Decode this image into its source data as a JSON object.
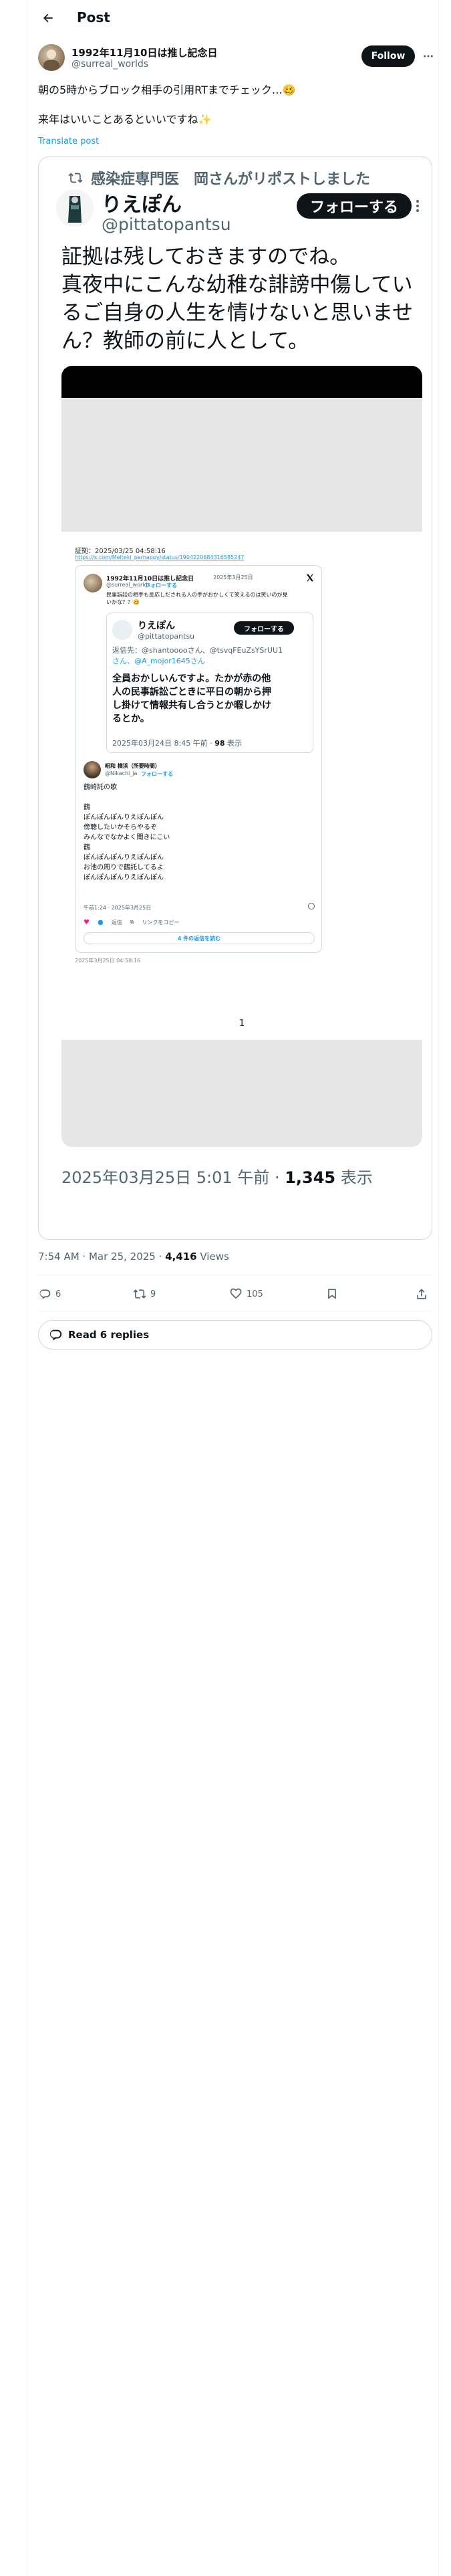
{
  "header": {
    "title": "Post"
  },
  "author": {
    "name": "1992年11月10日は推し記念日",
    "handle": "@surreal_worlds",
    "follow_label": "Follow"
  },
  "tweet": {
    "lines": [
      "朝の5時からブロック相手の引用RTまでチェック…🥴",
      "",
      "来年はいいことあるといいですね✨"
    ],
    "translate_label": "Translate post"
  },
  "quoted_shot": {
    "repost_text": "感染症専門医　岡さんがリポストしました",
    "name": "りえぽん",
    "handle": "@pittatopantsu",
    "follow_label": "フォローする",
    "text_lines": [
      "証拠は残しておきますのでね。",
      "真夜中にこんな幼稚な誹謗中傷してい",
      "るご自身の人生を情けないと思いませ",
      "ん？教師の前に人として。"
    ],
    "evidence_label": "証拠：2025/03/25 04:58:16",
    "evidence_link": "https://x.com/Meiteki_perhappy/status/1904220684316585247",
    "card": {
      "name": "1992年11月10日は推し記念日",
      "date": "2025年3月25日",
      "handle": "@surreal_worlds",
      "follow_label": "フォローする",
      "text_lines": [
        "民事訴訟の相手も反応しだされる人の手がおかしくて笑えるのは笑いのが見",
        "いかな？？🥴"
      ],
      "quote": {
        "name": "りえぽん",
        "handle": "@pittatopantsu",
        "follow_label": "フォローする",
        "reply_line1": "返信先：@shantooooさん、@tsvqFEuZsYSrUU1",
        "reply_line2": "さん、@A_mojor1645さん",
        "body_lines": [
          "全員おかしいんですよ。たかが赤の他",
          "人の民事訴訟ごときに平日の朝から押",
          "し掛けて情報共有し合うとか暇しかけ",
          "るとか。"
        ],
        "time": "2025年03月24日 8:45 午前",
        "views_num": "98",
        "views_label": "表示"
      },
      "second": {
        "name": "昭和 横浜（所要時間）",
        "handle": "@Nikachi_ja",
        "follow_label": "フォローする",
        "text_lines": [
          "鶴崎託の歌",
          "",
          "鶴",
          "ぽんぽんぽんりえぽんぽん",
          "傍聴したいかそらやるぞ",
          "みんなでなかよく聞きにこい",
          "鶴",
          "ぽんぽんぽんりえぽんぽん",
          "お池の周りで鶴託してるよ",
          "ぽんぽんぽんりえぽんぽん"
        ],
        "meta": "午前1:24 · 2025年3月25日",
        "reply_label": "返信",
        "copy_label": "リンクをコピー",
        "more_label": "4 件の返信を読む"
      },
      "footer_stamp": "2025年3月25日 04:58:16"
    },
    "page_number": "1",
    "meta_time": "2025年03月25日 5:01 午前",
    "meta_views_num": "1,345",
    "meta_views_label": "表示"
  },
  "post_meta": {
    "time": "7:54 AM · Mar 25, 2025",
    "views_num": "4,416",
    "views_label": "Views"
  },
  "actions": {
    "replies": "6",
    "reposts": "9",
    "likes": "105"
  },
  "read_replies_label": "Read 6 replies"
}
